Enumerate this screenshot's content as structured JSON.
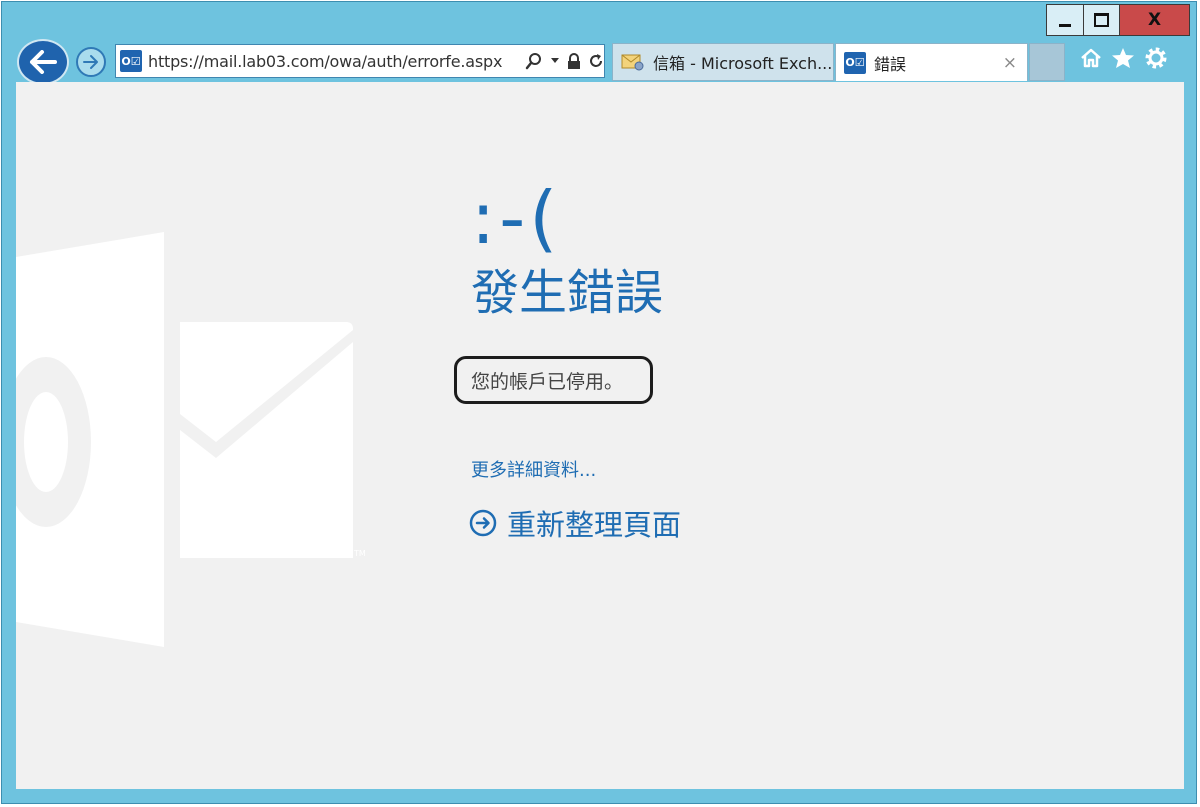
{
  "window": {
    "controls": {
      "minimize": "minimize",
      "maximize": "maximize",
      "close": "X"
    }
  },
  "toolbar": {
    "url": "https://mail.lab03.com/owa/auth/errorfe.aspx",
    "addr_icon": "O☑"
  },
  "tabs": [
    {
      "label": "信箱 - Microsoft Exch...",
      "icon": "mail-settings-icon"
    },
    {
      "label": "錯誤",
      "icon": "outlook-icon",
      "icon_text": "O☑",
      "close": "×"
    }
  ],
  "page": {
    "emoticon": ":-(",
    "title": "發生錯誤",
    "message": "您的帳戶已停用。",
    "more_link": "更多詳細資料...",
    "refresh": "重新整理頁面",
    "logo_tm": "TM"
  },
  "colors": {
    "accent": "#1f6db3",
    "frame": "#6ec3df",
    "close_button": "#c94a4a"
  }
}
